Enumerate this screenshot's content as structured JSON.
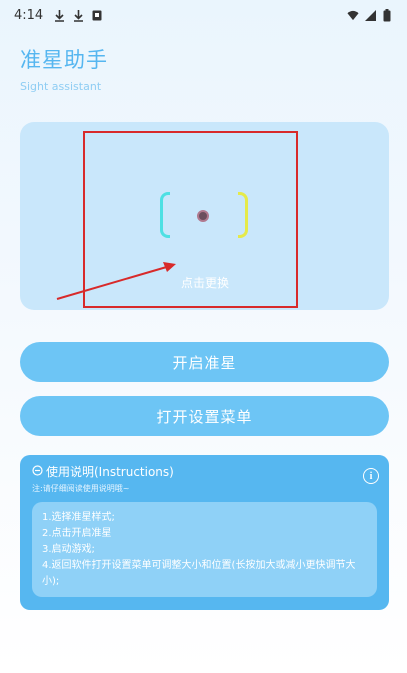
{
  "status": {
    "time": "4:14",
    "icons": [
      "download-icon",
      "download-icon",
      "notification-icon"
    ],
    "right_icons": [
      "wifi-icon",
      "signal-icon",
      "battery-icon"
    ]
  },
  "header": {
    "title": "准星助手",
    "subtitle": "Sight assistant"
  },
  "preview": {
    "change_label": "点击更换"
  },
  "buttons": {
    "enable": "开启准星",
    "open_menu": "打开设置菜单"
  },
  "instructions": {
    "title": "使用说明(Instructions)",
    "note": "注:请仔细阅读使用说明哦~",
    "steps": [
      "1.选择准星样式;",
      "2.点击开启准星",
      "3.启动游戏;",
      "4.返回软件打开设置菜单可调整大小和位置(长按加大或减小更快调节大小);"
    ]
  },
  "colors": {
    "accent": "#55b6f0",
    "button": "#6dc5f5",
    "panel": "#56b7f0",
    "highlight_box": "#d82a2a",
    "bracket_left": "#4ee0e3",
    "bracket_right": "#e5ea4a"
  }
}
